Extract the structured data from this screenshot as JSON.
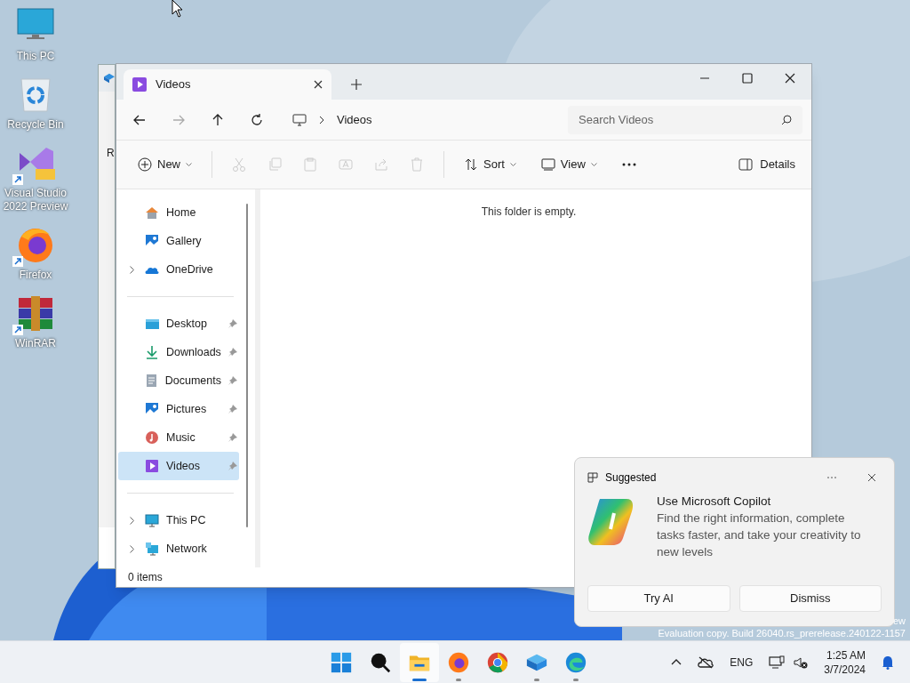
{
  "desktop_icons": [
    {
      "label": "This PC",
      "kind": "computer"
    },
    {
      "label": "Recycle Bin",
      "kind": "recycle-bin"
    },
    {
      "label": "Visual Studio 2022 Preview",
      "kind": "ide",
      "shortcut": true
    },
    {
      "label": "Firefox",
      "kind": "firefox",
      "shortcut": true
    },
    {
      "label": "WinRAR",
      "kind": "archive",
      "shortcut": true
    }
  ],
  "background_window": {
    "text": "R"
  },
  "explorer": {
    "tab": {
      "title": "Videos",
      "selected": true
    },
    "address": {
      "segments": [
        "Videos"
      ]
    },
    "search": {
      "placeholder": "Search Videos"
    },
    "toolbar": [
      {
        "kind": "new",
        "label": "New",
        "dropdown": true,
        "disabled": false
      },
      {
        "kind": "separator"
      },
      {
        "kind": "cut",
        "disabled": true
      },
      {
        "kind": "copy",
        "disabled": true
      },
      {
        "kind": "paste",
        "disabled": true
      },
      {
        "kind": "rename",
        "disabled": true
      },
      {
        "kind": "share",
        "disabled": true
      },
      {
        "kind": "delete",
        "disabled": true
      },
      {
        "kind": "separator"
      },
      {
        "kind": "sort",
        "label": "Sort",
        "dropdown": true,
        "disabled": false
      },
      {
        "kind": "view",
        "label": "View",
        "dropdown": true,
        "disabled": false
      },
      {
        "kind": "more",
        "disabled": false
      }
    ],
    "details_button": "Details",
    "sidebar": [
      [
        {
          "label": "Home",
          "kind": "home",
          "expandable": false,
          "pinned": false,
          "selected": false
        },
        {
          "label": "Gallery",
          "kind": "gallery",
          "expandable": false,
          "pinned": false,
          "selected": false
        },
        {
          "label": "OneDrive",
          "kind": "cloud",
          "expandable": true,
          "pinned": false,
          "selected": false
        }
      ],
      [
        {
          "label": "Desktop",
          "kind": "desktop",
          "expandable": false,
          "pinned": true,
          "selected": false
        },
        {
          "label": "Downloads",
          "kind": "download",
          "expandable": false,
          "pinned": true,
          "selected": false
        },
        {
          "label": "Documents",
          "kind": "document",
          "expandable": false,
          "pinned": true,
          "selected": false
        },
        {
          "label": "Pictures",
          "kind": "gallery",
          "expandable": false,
          "pinned": true,
          "selected": false
        },
        {
          "label": "Music",
          "kind": "music",
          "expandable": false,
          "pinned": true,
          "selected": false
        },
        {
          "label": "Videos",
          "kind": "video",
          "expandable": false,
          "pinned": true,
          "selected": true
        }
      ],
      [
        {
          "label": "This PC",
          "kind": "computer",
          "expandable": true,
          "pinned": false,
          "selected": false
        },
        {
          "label": "Network",
          "kind": "network",
          "expandable": true,
          "pinned": false,
          "selected": false
        }
      ]
    ],
    "empty_message": "This folder is empty.",
    "status": "0 items"
  },
  "toast": {
    "header": "Suggested",
    "title": "Use Microsoft Copilot",
    "body": "Find the right information, complete tasks faster, and take your creativity to new levels",
    "buttons": [
      "Try AI",
      "Dismiss"
    ]
  },
  "watermark": {
    "line_1": "ew",
    "line_2": "Evaluation copy. Build 26040.rs_prerelease.240122-1157"
  },
  "taskbar": {
    "apps": [
      {
        "kind": "start",
        "running": false,
        "active": false
      },
      {
        "kind": "search",
        "running": false,
        "active": false
      },
      {
        "kind": "explorer",
        "running": true,
        "active": true
      },
      {
        "kind": "firefox",
        "running": true,
        "active": false
      },
      {
        "kind": "chrome",
        "running": false,
        "active": false
      },
      {
        "kind": "box",
        "running": true,
        "active": false
      },
      {
        "kind": "edge",
        "running": true,
        "active": false
      }
    ],
    "language": "ENG",
    "time": "1:25 AM",
    "date": "3/7/2024"
  }
}
